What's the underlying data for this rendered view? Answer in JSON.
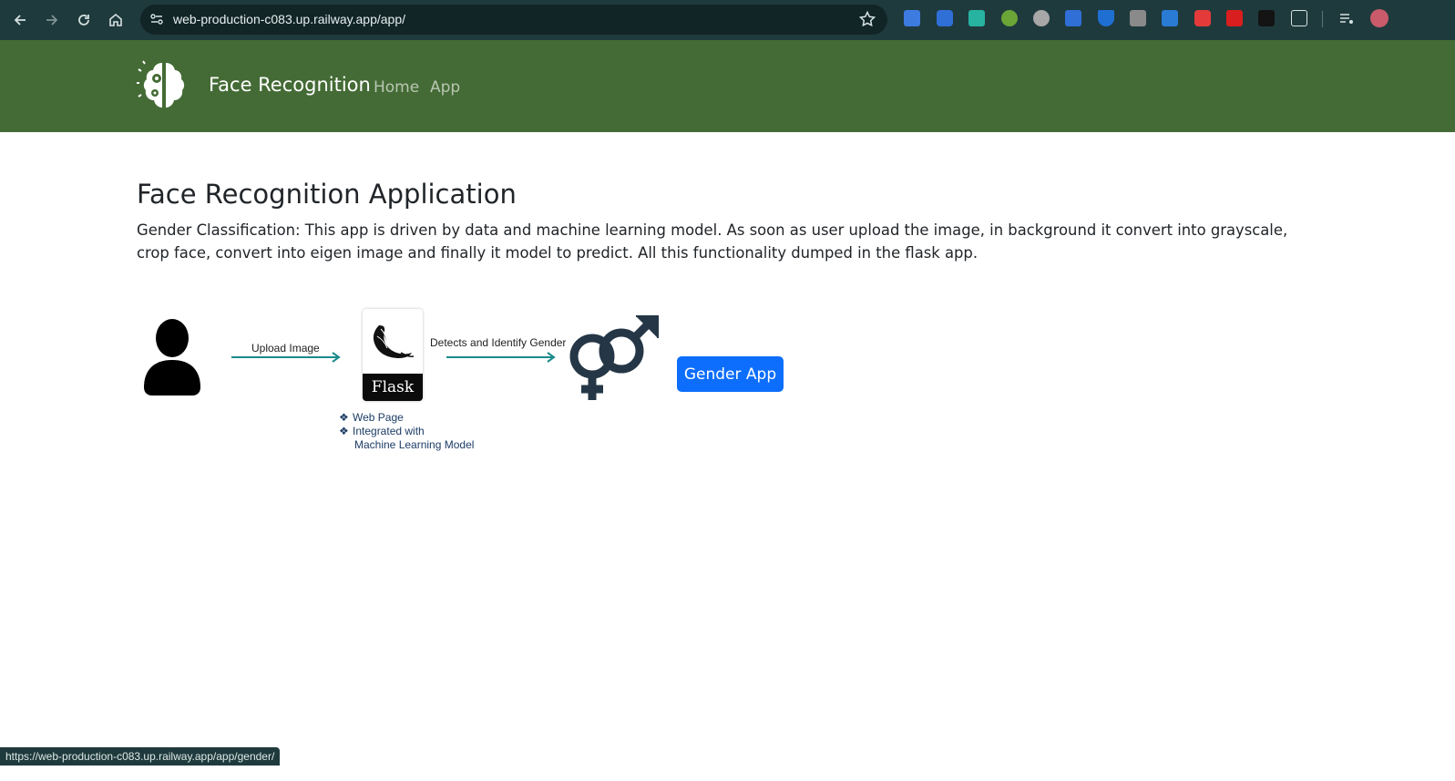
{
  "browser": {
    "url": "web-production-c083.up.railway.app/app/",
    "status_url": "https://web-production-c083.up.railway.app/app/gender/"
  },
  "navbar": {
    "brand": "Face Recognition",
    "links": [
      "Home",
      "App"
    ],
    "bg_color": "#446b35"
  },
  "main": {
    "title": "Face Recognition Application",
    "description": "Gender Classification: This app is driven by data and machine learning model. As soon as user upload the image, in background it convert into grayscale, crop face, convert into eigen image and finally it model to predict. All this functionality dumped in the flask app."
  },
  "diagram": {
    "upload_label": "Upload Image",
    "detect_label": "Detects and Identify Gender",
    "flask_label": "Flask",
    "notes": [
      "Web Page",
      "Integrated with",
      "Machine Learning Model"
    ]
  },
  "buttons": {
    "gender_app": "Gender App",
    "accent_color": "#0d6efd"
  }
}
